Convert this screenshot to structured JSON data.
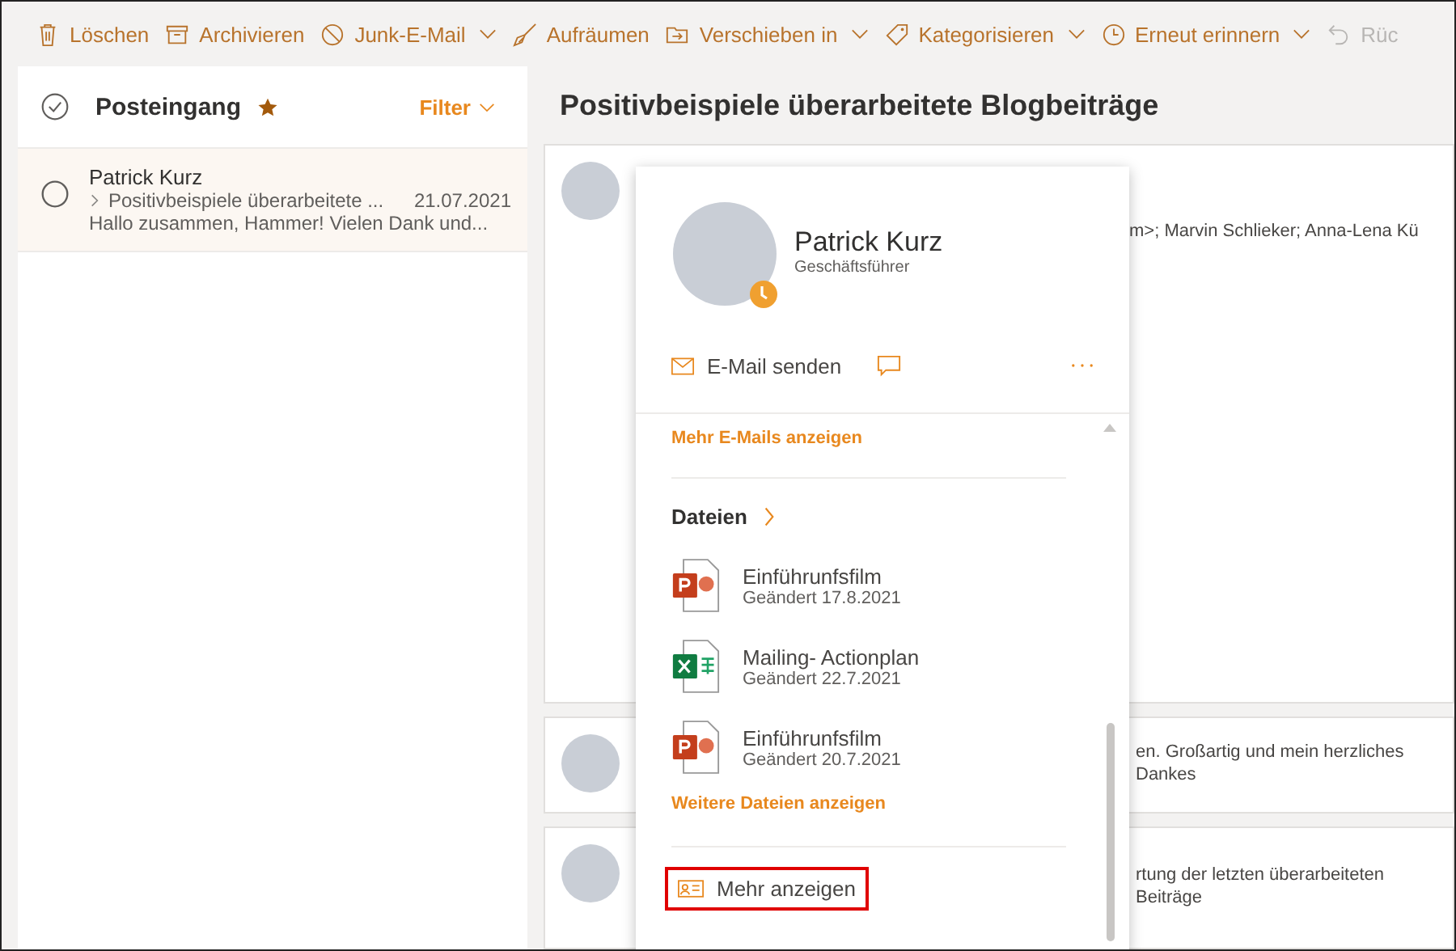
{
  "toolbar": [
    {
      "kind": "delete",
      "label": "Löschen",
      "dropdown": false,
      "disabled": false
    },
    {
      "kind": "archive",
      "label": "Archivieren",
      "dropdown": false,
      "disabled": false
    },
    {
      "kind": "block",
      "label": "Junk-E-Mail",
      "dropdown": true,
      "disabled": false
    },
    {
      "kind": "sweep",
      "label": "Aufräumen",
      "dropdown": false,
      "disabled": false
    },
    {
      "kind": "move",
      "label": "Verschieben in",
      "dropdown": true,
      "disabled": false
    },
    {
      "kind": "tag",
      "label": "Kategorisieren",
      "dropdown": true,
      "disabled": false
    },
    {
      "kind": "clock",
      "label": "Erneut erinnern",
      "dropdown": true,
      "disabled": false
    },
    {
      "kind": "undo",
      "label": "Rüc",
      "dropdown": false,
      "disabled": true
    }
  ],
  "folder": {
    "title": "Posteingang",
    "favorite": true,
    "filter": "Filter"
  },
  "messages": [
    {
      "sender": "Patrick Kurz",
      "subject": "Positivbeispiele überarbeitete ...",
      "date": "21.07.2021",
      "preview": "Hallo zusammen, Hammer! Vielen Dank und...",
      "selected": true
    }
  ],
  "reading": {
    "subject": "Positivbeispiele überarbeitete Blogbeiträge",
    "items": [
      {
        "text": "m>; Marvin Schlieker; Anna-Lena Kü"
      },
      {
        "text": "en. Großartig und mein herzliches Dankes"
      },
      {
        "text": "rtung der letzten überarbeiteten Beiträge"
      }
    ]
  },
  "contact_card": {
    "name": "Patrick Kurz",
    "role": "Geschäftsführer",
    "away": true,
    "send_mail": "E-Mail senden",
    "more_mails": "Mehr E-Mails anzeigen",
    "files_heading": "Dateien",
    "files": [
      {
        "kind": "powerpoint",
        "name": "Einführunfsfilm",
        "modified": "Geändert 17.8.2021"
      },
      {
        "kind": "excel",
        "name": "Mailing- Actionplan",
        "modified": "Geändert 22.7.2021"
      },
      {
        "kind": "powerpoint",
        "name": "Einführunfsfilm",
        "modified": "Geändert 20.7.2021"
      }
    ],
    "more_files": "Weitere Dateien anzeigen",
    "show_more": "Mehr anzeigen",
    "show_more_highlighted": true
  }
}
